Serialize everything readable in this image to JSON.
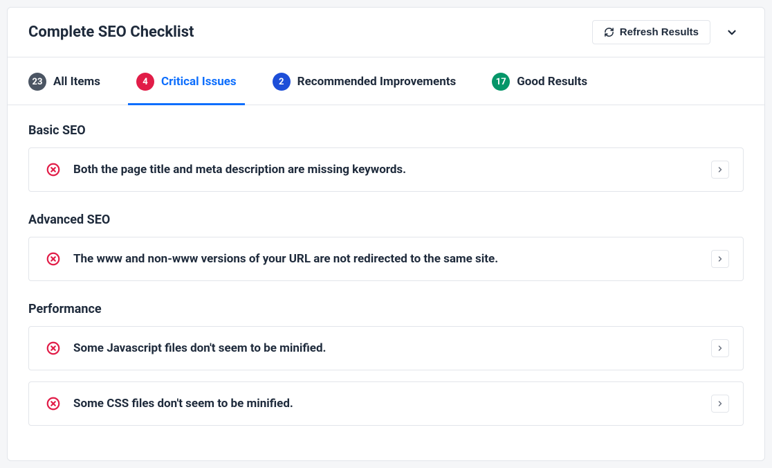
{
  "header": {
    "title": "Complete SEO Checklist",
    "refresh_label": "Refresh Results"
  },
  "tabs": {
    "all": {
      "count": "23",
      "label": "All Items"
    },
    "critical": {
      "count": "4",
      "label": "Critical Issues"
    },
    "recommended": {
      "count": "2",
      "label": "Recommended Improvements"
    },
    "good": {
      "count": "17",
      "label": "Good Results"
    }
  },
  "sections": {
    "basic": {
      "title": "Basic SEO"
    },
    "advanced": {
      "title": "Advanced SEO"
    },
    "performance": {
      "title": "Performance"
    }
  },
  "issues": {
    "basic_0": "Both the page title and meta description are missing keywords.",
    "advanced_0": "The www and non-www versions of your URL are not redirected to the same site.",
    "performance_0": "Some Javascript files don't seem to be minified.",
    "performance_1": "Some CSS files don't seem to be minified."
  }
}
